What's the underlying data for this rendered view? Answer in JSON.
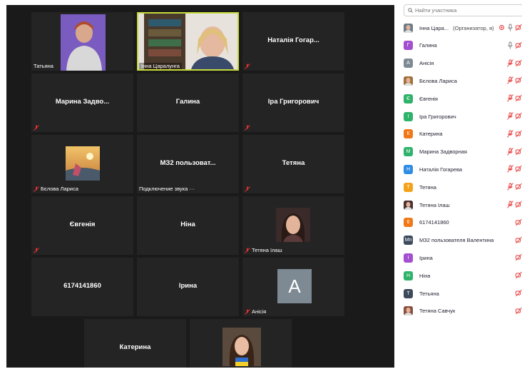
{
  "search": {
    "placeholder": "Найти участника"
  },
  "tiles": {
    "tatyana": {
      "label": "Татьяна"
    },
    "inna": {
      "label": "Інна Царалунга"
    },
    "natalia": {
      "name": "Наталія Гогар..."
    },
    "maryna": {
      "name": "Марина Задво..."
    },
    "galina": {
      "name": "Галина"
    },
    "ira": {
      "name": "Іра Григорович"
    },
    "bielova": {
      "label": "Бєлова Лариса"
    },
    "mz": {
      "name": "МЗ2 пользоват...",
      "label": "Подключение звука ···"
    },
    "tetyana": {
      "name": "Тетяна"
    },
    "yevheniia": {
      "name": "Євгенія"
    },
    "nina": {
      "name": "Ніна"
    },
    "ilash": {
      "label": "Тетяна Ілаш"
    },
    "phone": {
      "name": "6174141860"
    },
    "iryna": {
      "name": "Ірина"
    },
    "anisiia": {
      "letter": "A",
      "label": "Анісія"
    },
    "kateryna": {
      "name": "Катерина"
    }
  },
  "participants": [
    {
      "name": "Інна Цара...",
      "role": "(Организатор, я)",
      "initial": "",
      "color": "#6b7b8a"
    },
    {
      "name": "Галина",
      "initial": "Г",
      "color": "#a34fcf"
    },
    {
      "name": "Анісія",
      "initial": "A",
      "color": "#7d8a93"
    },
    {
      "name": "Бєлова Лариса",
      "initial": "",
      "color": "#a0703a"
    },
    {
      "name": "Євгенія",
      "initial": "Є",
      "color": "#2fb36b"
    },
    {
      "name": "Іра Григорович",
      "initial": "І",
      "color": "#2fb36b"
    },
    {
      "name": "Катерина",
      "initial": "К",
      "color": "#f07818"
    },
    {
      "name": "Марина Задворная",
      "initial": "М",
      "color": "#2fb36b"
    },
    {
      "name": "Наталія Гогарева",
      "initial": "Н",
      "color": "#2d8ce6"
    },
    {
      "name": "Тетяна",
      "initial": "Т",
      "color": "#f5a21b"
    },
    {
      "name": "Тетяна Ілаш",
      "initial": "",
      "color": "#4a3030"
    },
    {
      "name": "6174141860",
      "initial": "6",
      "color": "#f07818"
    },
    {
      "name": "МЗ2 пользователя Валентина",
      "initial": "Мп",
      "color": "#3c4a5c"
    },
    {
      "name": "Ірина",
      "initial": "І",
      "color": "#a34fcf"
    },
    {
      "name": "Ніна",
      "initial": "Н",
      "color": "#2fb36b"
    },
    {
      "name": "Тетьяна",
      "initial": "Т",
      "color": "#3c4a5c"
    },
    {
      "name": "Тетяна Савчук",
      "initial": "",
      "color": "#8a5040"
    }
  ],
  "colors": {
    "active_border": "#c7d93a",
    "muted": "#e5302f"
  }
}
